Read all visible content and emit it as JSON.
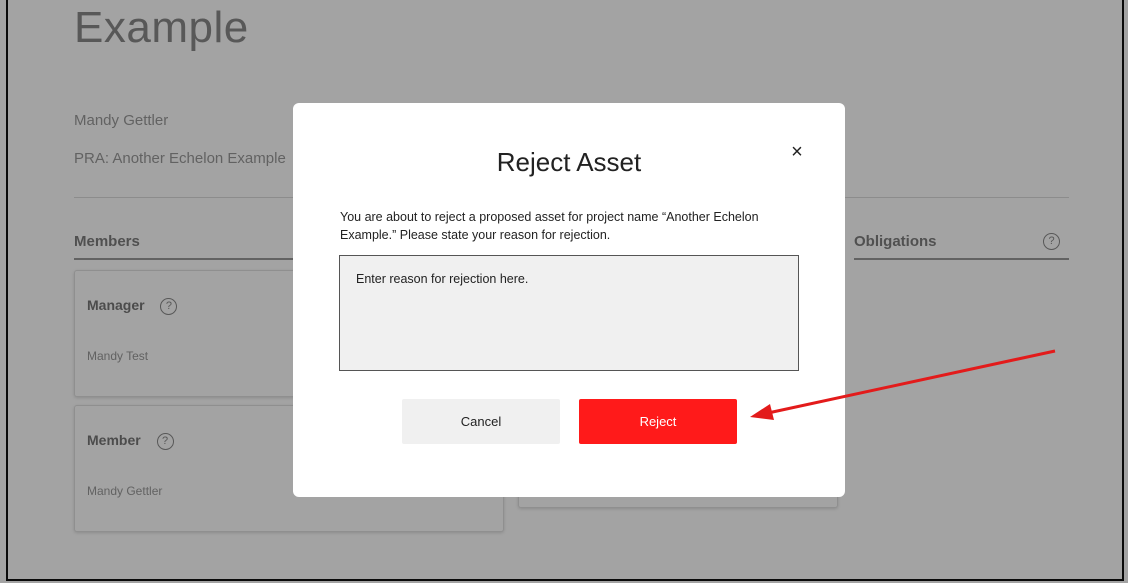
{
  "page": {
    "title": "Example",
    "owner": "Mandy Gettler",
    "pra": "PRA: Another Echelon Example"
  },
  "sections": {
    "members_title": "Members",
    "obligations_title": "Obligations"
  },
  "cards": [
    {
      "title": "Manager",
      "name": "Mandy Test"
    },
    {
      "title": "Member",
      "name": "Mandy Gettler"
    }
  ],
  "icons": {
    "help": "?",
    "close": "×"
  },
  "modal": {
    "title": "Reject Asset",
    "description": "You are about to reject a proposed asset for project name “Another Echelon Example.” Please state your reason for rejection.",
    "placeholder": "Enter reason for rejection here.",
    "cancel_label": "Cancel",
    "reject_label": "Reject"
  },
  "colors": {
    "reject_button": "#ff1a1a",
    "annotation_arrow": "#e31b1b",
    "overlay": "rgba(0,0,0,0.36)"
  }
}
